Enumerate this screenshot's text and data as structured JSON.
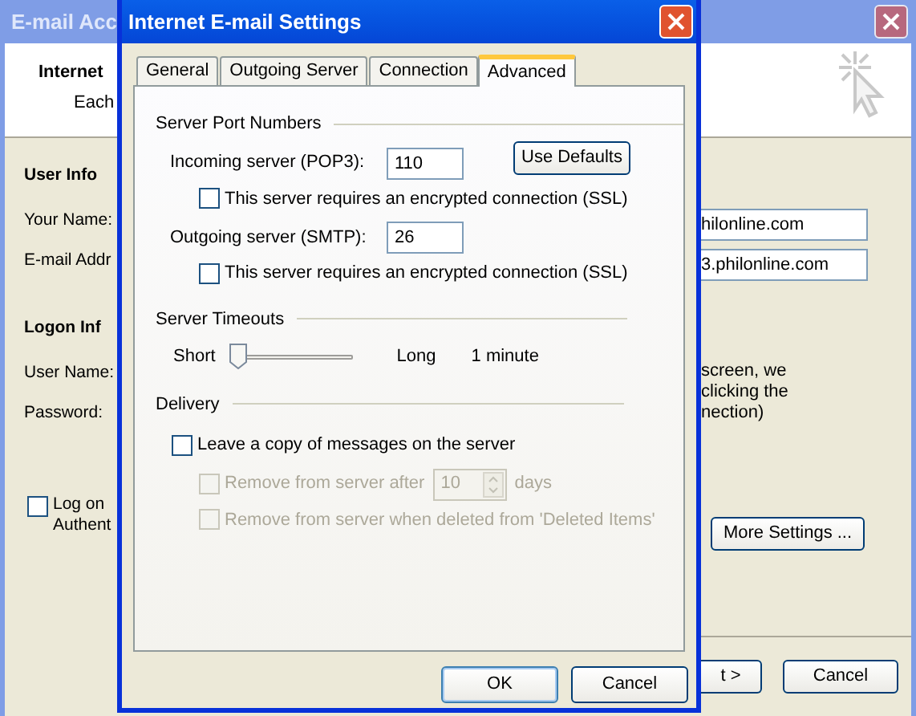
{
  "background_window": {
    "title": "E-mail Acc",
    "header": {
      "title": "Internet",
      "subtitle": "Each"
    },
    "sections": [
      {
        "heading": "User Info",
        "fields": [
          {
            "label": "Your Name:",
            "value": "hilonline.com"
          },
          {
            "label": "E-mail Addr",
            "value": "3.philonline.com"
          }
        ]
      },
      {
        "heading": "Logon Inf",
        "fields": [
          {
            "label": "User Name:"
          },
          {
            "label": "Password:"
          }
        ]
      }
    ],
    "note": [
      "screen, we",
      "clicking the",
      "nection)"
    ],
    "logon_checkbox": {
      "lines": [
        "Log on",
        "Authent"
      ],
      "checked": false
    },
    "more_settings": "More Settings ...",
    "buttons": [
      "t >",
      "Cancel"
    ]
  },
  "dialog": {
    "title": "Internet E-mail Settings",
    "tabs": [
      {
        "label": "General",
        "selected": false
      },
      {
        "label": "Outgoing Server",
        "selected": false
      },
      {
        "label": "Connection",
        "selected": false
      },
      {
        "label": "Advanced",
        "selected": true
      }
    ],
    "port_group": {
      "heading": "Server Port Numbers",
      "use_defaults": "Use Defaults",
      "servers": [
        {
          "label": "Incoming server (POP3):",
          "value": "110",
          "ssl": {
            "label": "This server requires an encrypted connection (SSL)",
            "checked": false
          }
        },
        {
          "label": "Outgoing server (SMTP):",
          "value": "26",
          "ssl": {
            "label": "This server requires an encrypted connection (SSL)",
            "checked": false
          }
        }
      ]
    },
    "timeout_group": {
      "heading": "Server Timeouts",
      "min_label": "Short",
      "max_label": "Long",
      "level": 0.05,
      "reading": "1 minute"
    },
    "delivery_group": {
      "heading": "Delivery",
      "leave_copy": {
        "label": "Leave a copy of messages on the server",
        "checked": false,
        "disabled": false
      },
      "remove_after": {
        "label": "Remove from server after",
        "checked": false,
        "disabled": true,
        "value": "10",
        "unit": "days"
      },
      "remove_deleted": {
        "label": "Remove from server when deleted from 'Deleted Items'",
        "checked": false,
        "disabled": true
      }
    },
    "buttons": [
      "OK",
      "Cancel"
    ]
  }
}
